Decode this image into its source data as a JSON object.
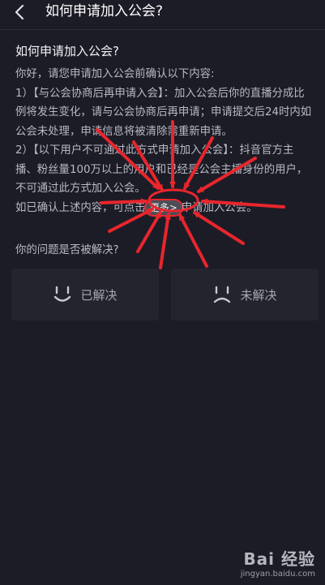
{
  "header": {
    "title": "如何申请加入公会?"
  },
  "question": {
    "title": "如何申请加入公会?"
  },
  "content": {
    "intro": "你好，请您申请加入公会前确认以下内容:",
    "item1": "1）【与公会协商后再申请入会】：加入公会后你的直播分成比例将发生变化，请与公会协商后再申请；申请提交后24时内如公会未处理，申请信息将被清除需重新申请。",
    "item2": "2）【以下用户不可通过此方式申请加入公会】：抖音官方主播、粉丝量100万以上的用户和已经是公会主播身份的用户，不可通过此方式加入公会。",
    "confirm_prefix": "如已确认上述内容，可点击",
    "more_link": "更多>",
    "confirm_suffix": "申请加入公会。"
  },
  "feedback": {
    "question": "你的问题是否被解决?",
    "solved_label": "已解决",
    "unsolved_label": "未解决"
  },
  "watermark": {
    "logo": "Bai 经验",
    "url": "jingyan.baidu.com"
  },
  "colors": {
    "background": "#1c1c27",
    "annotation_red": "#e8262c",
    "button_bg": "#24242f"
  }
}
